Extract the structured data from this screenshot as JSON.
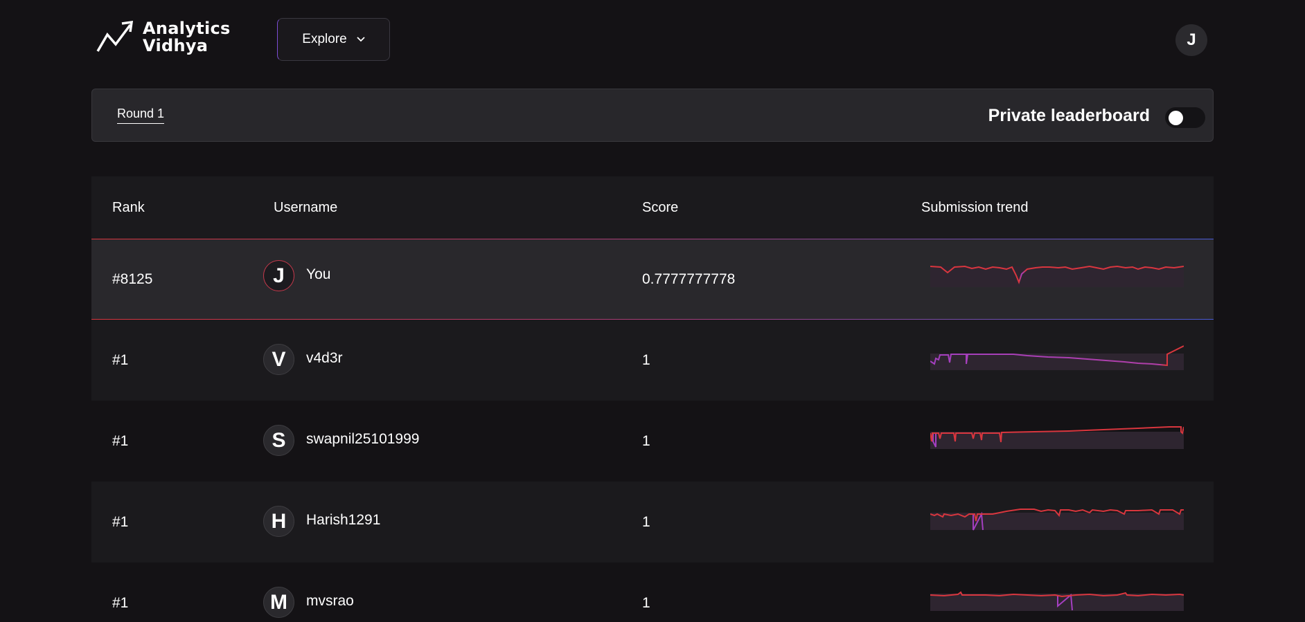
{
  "brand": {
    "line1": "Analytics",
    "line2": "Vidhya"
  },
  "nav": {
    "explore_label": "Explore",
    "user_initial": "J"
  },
  "round_bar": {
    "tab_label": "Round 1",
    "private_label": "Private leaderboard",
    "private_enabled": false
  },
  "table": {
    "headers": {
      "rank": "Rank",
      "username": "Username",
      "score": "Score",
      "trend": "Submission trend"
    },
    "rows": [
      {
        "rank": "#8125",
        "initial": "J",
        "username": "You",
        "score": "0.7777777778"
      },
      {
        "rank": "#1",
        "initial": "V",
        "username": "v4d3r",
        "score": "1"
      },
      {
        "rank": "#1",
        "initial": "S",
        "username": "swapnil25101999",
        "score": "1"
      },
      {
        "rank": "#1",
        "initial": "H",
        "username": "Harish1291",
        "score": "1"
      },
      {
        "rank": "#1",
        "initial": "M",
        "username": "mvsrao",
        "score": "1"
      }
    ]
  },
  "colors": {
    "accent_red": "#d9363e",
    "accent_purple": "#a43fc0",
    "accent_blue": "#4a5cd9",
    "background": "#141215"
  }
}
